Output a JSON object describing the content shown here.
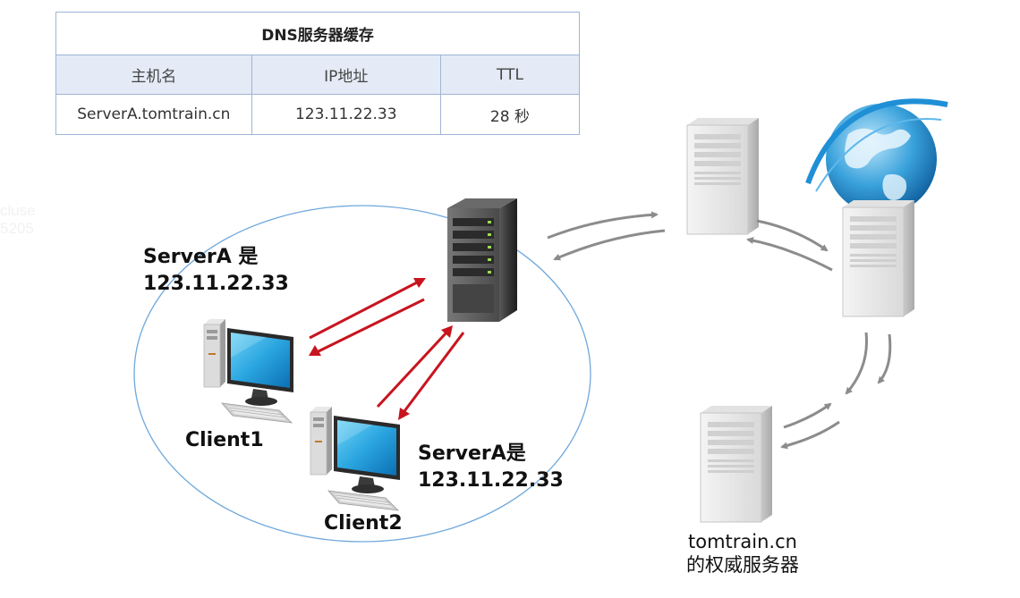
{
  "cache_table": {
    "title": "DNS服务器缓存",
    "headers": [
      "主机名",
      "IP地址",
      "TTL"
    ],
    "row": [
      "ServerA.tomtrain.cn",
      "123.11.22.33",
      "28 秒"
    ]
  },
  "labels": {
    "answer1_line1": "ServerA 是",
    "answer1_line2": "123.11.22.33",
    "answer2_line1": "ServerA是",
    "answer2_line2": "123.11.22.33",
    "client1": "Client1",
    "client2": "Client2",
    "auth_line1": "tomtrain.cn",
    "auth_line2": "的权威服务器"
  },
  "watermark": {
    "line1": "cluse",
    "line2": "5205"
  },
  "colors": {
    "arrow_red": "#c8141e",
    "arrow_gray": "#8c8c8c",
    "lan_ellipse": "#6fa8dc",
    "table_border": "#9fb4d6",
    "table_header_bg": "#e4ebf6",
    "globe_blue": "#1f8fd6"
  }
}
